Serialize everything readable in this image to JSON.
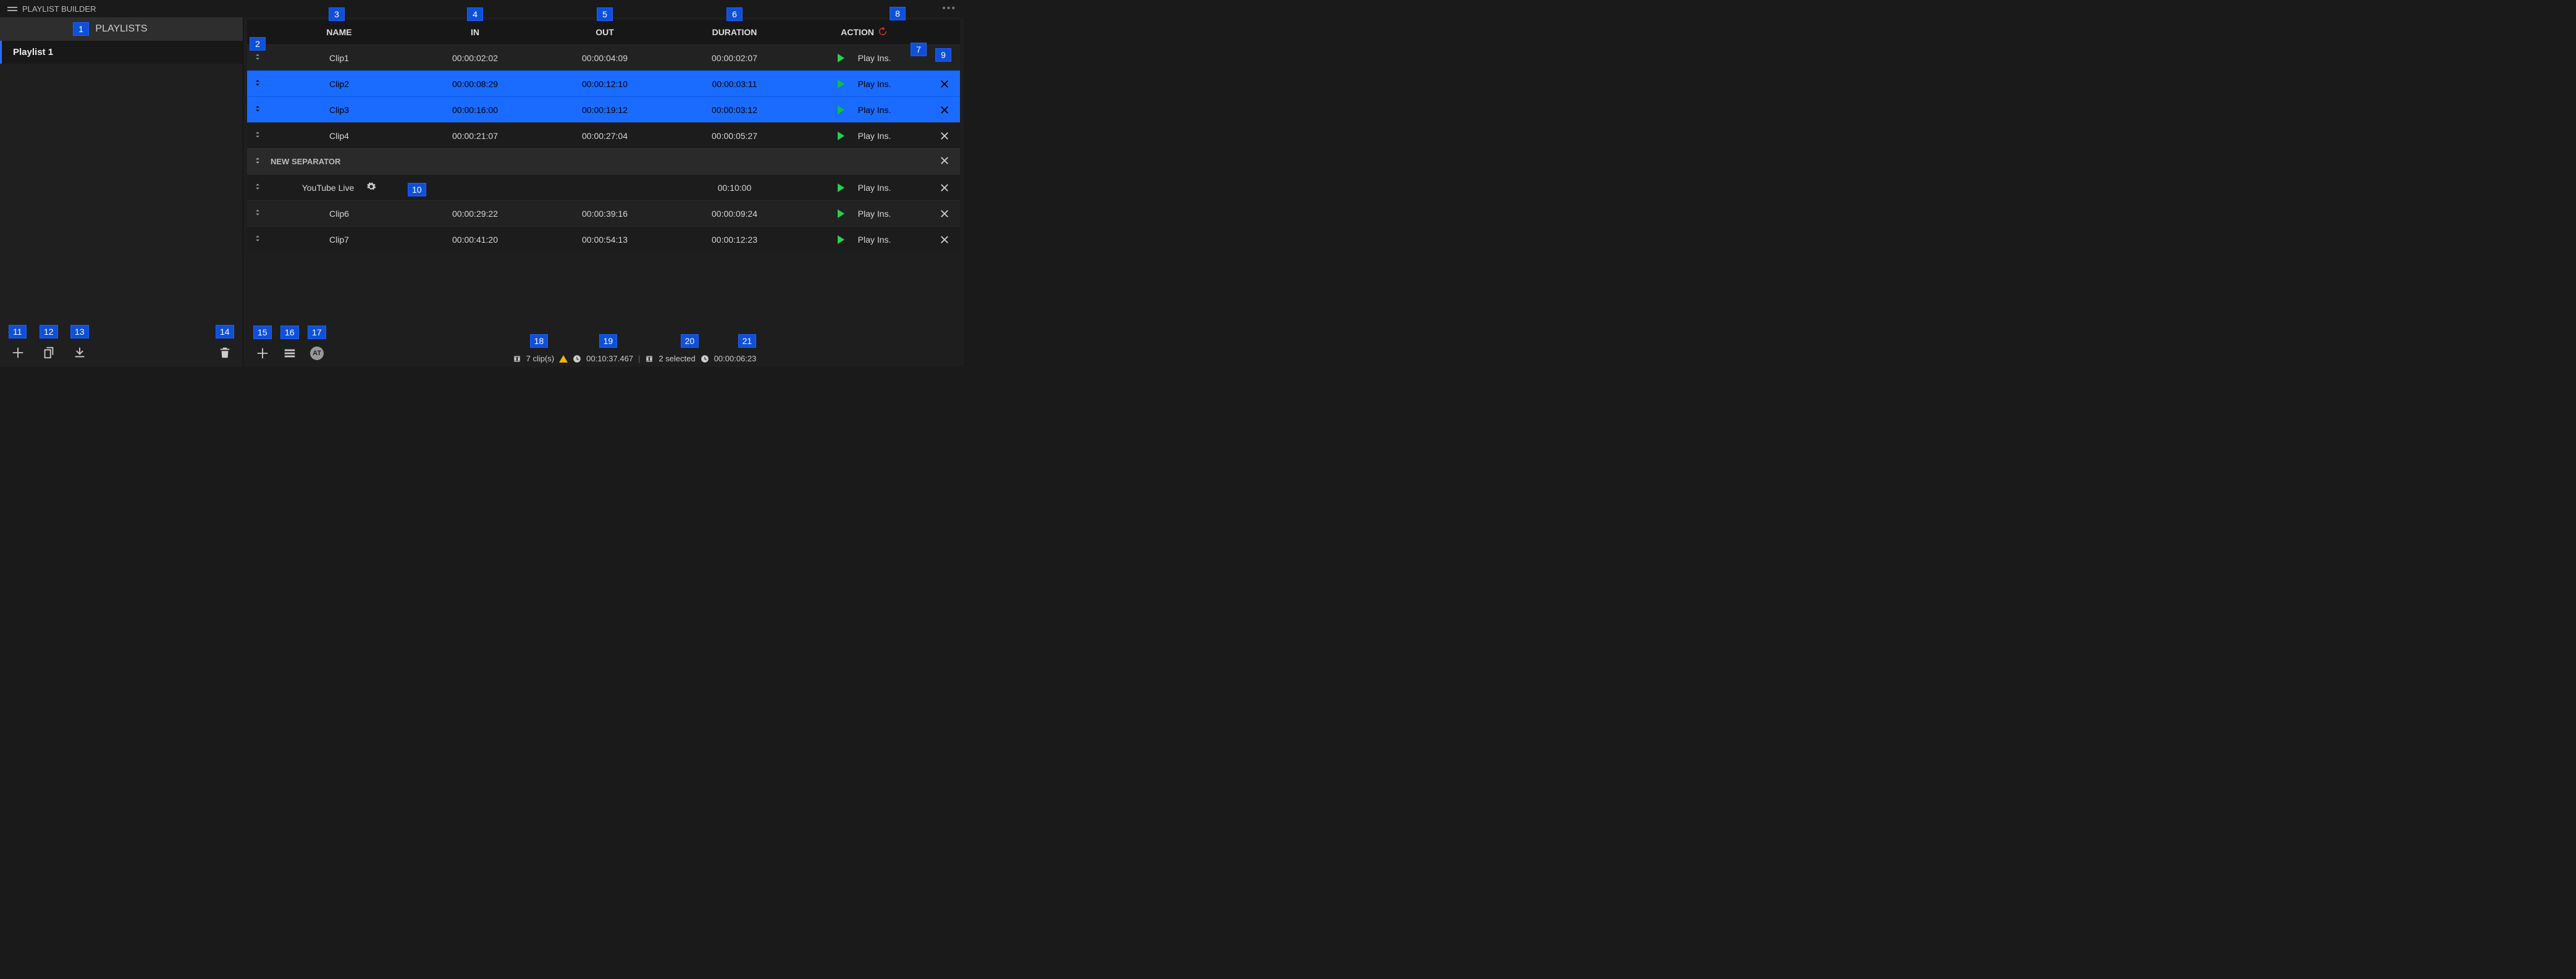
{
  "title": "PLAYLIST BUILDER",
  "sidebar": {
    "header": "PLAYLISTS",
    "items": [
      {
        "label": "Playlist 1"
      }
    ]
  },
  "table": {
    "headers": {
      "name": "NAME",
      "in": "IN",
      "out": "OUT",
      "duration": "DURATION",
      "action": "ACTION"
    },
    "rows": [
      {
        "type": "clip",
        "selected": false,
        "name": "Clip1",
        "in": "00:00:02:02",
        "out": "00:00:04:09",
        "duration": "00:00:02:07",
        "action": "Play Ins."
      },
      {
        "type": "clip",
        "selected": true,
        "name": "Clip2",
        "in": "00:00:08:29",
        "out": "00:00:12:10",
        "duration": "00:00:03:11",
        "action": "Play Ins."
      },
      {
        "type": "clip",
        "selected": true,
        "name": "Clip3",
        "in": "00:00:16:00",
        "out": "00:00:19:12",
        "duration": "00:00:03:12",
        "action": "Play Ins."
      },
      {
        "type": "clip",
        "selected": false,
        "name": "Clip4",
        "in": "00:00:21:07",
        "out": "00:00:27:04",
        "duration": "00:00:05:27",
        "action": "Play Ins."
      },
      {
        "type": "separator",
        "label": "NEW SEPARATOR"
      },
      {
        "type": "clip",
        "selected": false,
        "name": "YouTube Live",
        "in": "",
        "out": "",
        "duration": "00:10:00",
        "action": "Play Ins.",
        "gear": true
      },
      {
        "type": "clip",
        "selected": false,
        "name": "Clip6",
        "in": "00:00:29:22",
        "out": "00:00:39:16",
        "duration": "00:00:09:24",
        "action": "Play Ins."
      },
      {
        "type": "clip",
        "selected": false,
        "name": "Clip7",
        "in": "00:00:41:20",
        "out": "00:00:54:13",
        "duration": "00:00:12:23",
        "action": "Play Ins."
      }
    ]
  },
  "status": {
    "clip_count": "7 clip(s)",
    "total_duration": "00:10:37.467",
    "selected_count": "2 selected",
    "selected_duration": "00:00:06:23"
  },
  "at_label": "AT",
  "callouts": {
    "c1": "1",
    "c2": "2",
    "c3": "3",
    "c4": "4",
    "c5": "5",
    "c6": "6",
    "c7": "7",
    "c8": "8",
    "c9": "9",
    "c10": "10",
    "c11": "11",
    "c12": "12",
    "c13": "13",
    "c14": "14",
    "c15": "15",
    "c16": "16",
    "c17": "17",
    "c18": "18",
    "c19": "19",
    "c20": "20",
    "c21": "21"
  }
}
